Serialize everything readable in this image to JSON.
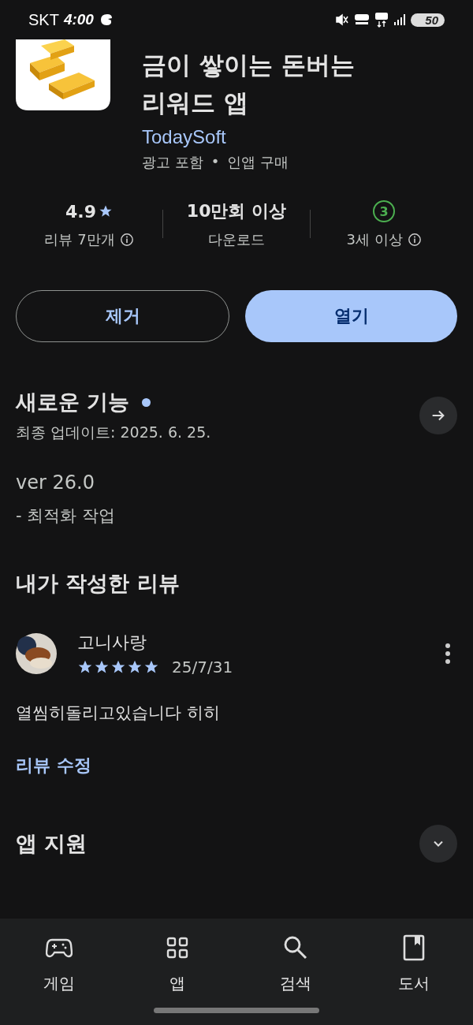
{
  "status_bar": {
    "carrier": "SKT",
    "time": "4:00",
    "battery": "50"
  },
  "app": {
    "title_lines": [
      "금이 쌓이는 돈버는",
      "리워드 앱"
    ],
    "developer": "TodaySoft",
    "tags": [
      "광고 포함",
      "인앱 구매"
    ],
    "separator": "•"
  },
  "stats": [
    {
      "kind": "rating",
      "value": "4.9",
      "label": "리뷰 7만개",
      "info": true
    },
    {
      "kind": "text",
      "value": "10만회 이상",
      "label": "다운로드",
      "info": false
    },
    {
      "kind": "age",
      "value": "3",
      "label": "3세 이상",
      "info": true
    }
  ],
  "buttons": [
    {
      "label": "제거",
      "kind": "outline"
    },
    {
      "label": "열기",
      "kind": "filled"
    }
  ],
  "whats_new": {
    "title": "새로운 기능",
    "new_dot": true,
    "updated": "최종 업데이트: 2025. 6. 25.",
    "version": "ver 26.0",
    "notes": "- 최적화 작업"
  },
  "my_review": {
    "title": "내가 작성한 리뷰",
    "author": "고니사랑",
    "stars": 5,
    "date": "25/7/31",
    "text": "열씸히돌리고있습니다 히히",
    "edit_link": "리뷰 수정"
  },
  "support": {
    "title": "앱 지원",
    "expanded": false
  },
  "nav": [
    {
      "kind": "games",
      "label": "게임",
      "selected": false
    },
    {
      "kind": "apps",
      "label": "앱",
      "selected": false
    },
    {
      "kind": "search",
      "label": "검색",
      "selected": false
    },
    {
      "kind": "books",
      "label": "도서",
      "selected": false
    }
  ]
}
